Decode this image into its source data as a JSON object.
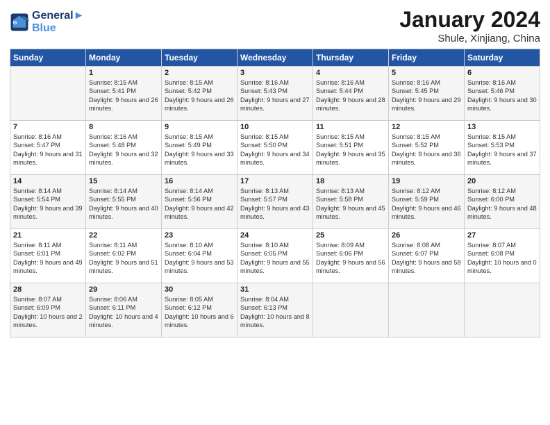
{
  "header": {
    "logo_line1": "General",
    "logo_line2": "Blue",
    "title": "January 2024",
    "subtitle": "Shule, Xinjiang, China"
  },
  "columns": [
    "Sunday",
    "Monday",
    "Tuesday",
    "Wednesday",
    "Thursday",
    "Friday",
    "Saturday"
  ],
  "weeks": [
    [
      {
        "day": "",
        "sunrise": "",
        "sunset": "",
        "daylight": ""
      },
      {
        "day": "1",
        "sunrise": "Sunrise: 8:15 AM",
        "sunset": "Sunset: 5:41 PM",
        "daylight": "Daylight: 9 hours and 26 minutes."
      },
      {
        "day": "2",
        "sunrise": "Sunrise: 8:15 AM",
        "sunset": "Sunset: 5:42 PM",
        "daylight": "Daylight: 9 hours and 26 minutes."
      },
      {
        "day": "3",
        "sunrise": "Sunrise: 8:16 AM",
        "sunset": "Sunset: 5:43 PM",
        "daylight": "Daylight: 9 hours and 27 minutes."
      },
      {
        "day": "4",
        "sunrise": "Sunrise: 8:16 AM",
        "sunset": "Sunset: 5:44 PM",
        "daylight": "Daylight: 9 hours and 28 minutes."
      },
      {
        "day": "5",
        "sunrise": "Sunrise: 8:16 AM",
        "sunset": "Sunset: 5:45 PM",
        "daylight": "Daylight: 9 hours and 29 minutes."
      },
      {
        "day": "6",
        "sunrise": "Sunrise: 8:16 AM",
        "sunset": "Sunset: 5:46 PM",
        "daylight": "Daylight: 9 hours and 30 minutes."
      }
    ],
    [
      {
        "day": "7",
        "sunrise": "Sunrise: 8:16 AM",
        "sunset": "Sunset: 5:47 PM",
        "daylight": "Daylight: 9 hours and 31 minutes."
      },
      {
        "day": "8",
        "sunrise": "Sunrise: 8:16 AM",
        "sunset": "Sunset: 5:48 PM",
        "daylight": "Daylight: 9 hours and 32 minutes."
      },
      {
        "day": "9",
        "sunrise": "Sunrise: 8:15 AM",
        "sunset": "Sunset: 5:49 PM",
        "daylight": "Daylight: 9 hours and 33 minutes."
      },
      {
        "day": "10",
        "sunrise": "Sunrise: 8:15 AM",
        "sunset": "Sunset: 5:50 PM",
        "daylight": "Daylight: 9 hours and 34 minutes."
      },
      {
        "day": "11",
        "sunrise": "Sunrise: 8:15 AM",
        "sunset": "Sunset: 5:51 PM",
        "daylight": "Daylight: 9 hours and 35 minutes."
      },
      {
        "day": "12",
        "sunrise": "Sunrise: 8:15 AM",
        "sunset": "Sunset: 5:52 PM",
        "daylight": "Daylight: 9 hours and 36 minutes."
      },
      {
        "day": "13",
        "sunrise": "Sunrise: 8:15 AM",
        "sunset": "Sunset: 5:53 PM",
        "daylight": "Daylight: 9 hours and 37 minutes."
      }
    ],
    [
      {
        "day": "14",
        "sunrise": "Sunrise: 8:14 AM",
        "sunset": "Sunset: 5:54 PM",
        "daylight": "Daylight: 9 hours and 39 minutes."
      },
      {
        "day": "15",
        "sunrise": "Sunrise: 8:14 AM",
        "sunset": "Sunset: 5:55 PM",
        "daylight": "Daylight: 9 hours and 40 minutes."
      },
      {
        "day": "16",
        "sunrise": "Sunrise: 8:14 AM",
        "sunset": "Sunset: 5:56 PM",
        "daylight": "Daylight: 9 hours and 42 minutes."
      },
      {
        "day": "17",
        "sunrise": "Sunrise: 8:13 AM",
        "sunset": "Sunset: 5:57 PM",
        "daylight": "Daylight: 9 hours and 43 minutes."
      },
      {
        "day": "18",
        "sunrise": "Sunrise: 8:13 AM",
        "sunset": "Sunset: 5:58 PM",
        "daylight": "Daylight: 9 hours and 45 minutes."
      },
      {
        "day": "19",
        "sunrise": "Sunrise: 8:12 AM",
        "sunset": "Sunset: 5:59 PM",
        "daylight": "Daylight: 9 hours and 46 minutes."
      },
      {
        "day": "20",
        "sunrise": "Sunrise: 8:12 AM",
        "sunset": "Sunset: 6:00 PM",
        "daylight": "Daylight: 9 hours and 48 minutes."
      }
    ],
    [
      {
        "day": "21",
        "sunrise": "Sunrise: 8:11 AM",
        "sunset": "Sunset: 6:01 PM",
        "daylight": "Daylight: 9 hours and 49 minutes."
      },
      {
        "day": "22",
        "sunrise": "Sunrise: 8:11 AM",
        "sunset": "Sunset: 6:02 PM",
        "daylight": "Daylight: 9 hours and 51 minutes."
      },
      {
        "day": "23",
        "sunrise": "Sunrise: 8:10 AM",
        "sunset": "Sunset: 6:04 PM",
        "daylight": "Daylight: 9 hours and 53 minutes."
      },
      {
        "day": "24",
        "sunrise": "Sunrise: 8:10 AM",
        "sunset": "Sunset: 6:05 PM",
        "daylight": "Daylight: 9 hours and 55 minutes."
      },
      {
        "day": "25",
        "sunrise": "Sunrise: 8:09 AM",
        "sunset": "Sunset: 6:06 PM",
        "daylight": "Daylight: 9 hours and 56 minutes."
      },
      {
        "day": "26",
        "sunrise": "Sunrise: 8:08 AM",
        "sunset": "Sunset: 6:07 PM",
        "daylight": "Daylight: 9 hours and 58 minutes."
      },
      {
        "day": "27",
        "sunrise": "Sunrise: 8:07 AM",
        "sunset": "Sunset: 6:08 PM",
        "daylight": "Daylight: 10 hours and 0 minutes."
      }
    ],
    [
      {
        "day": "28",
        "sunrise": "Sunrise: 8:07 AM",
        "sunset": "Sunset: 6:09 PM",
        "daylight": "Daylight: 10 hours and 2 minutes."
      },
      {
        "day": "29",
        "sunrise": "Sunrise: 8:06 AM",
        "sunset": "Sunset: 6:11 PM",
        "daylight": "Daylight: 10 hours and 4 minutes."
      },
      {
        "day": "30",
        "sunrise": "Sunrise: 8:05 AM",
        "sunset": "Sunset: 6:12 PM",
        "daylight": "Daylight: 10 hours and 6 minutes."
      },
      {
        "day": "31",
        "sunrise": "Sunrise: 8:04 AM",
        "sunset": "Sunset: 6:13 PM",
        "daylight": "Daylight: 10 hours and 8 minutes."
      },
      {
        "day": "",
        "sunrise": "",
        "sunset": "",
        "daylight": ""
      },
      {
        "day": "",
        "sunrise": "",
        "sunset": "",
        "daylight": ""
      },
      {
        "day": "",
        "sunrise": "",
        "sunset": "",
        "daylight": ""
      }
    ]
  ]
}
